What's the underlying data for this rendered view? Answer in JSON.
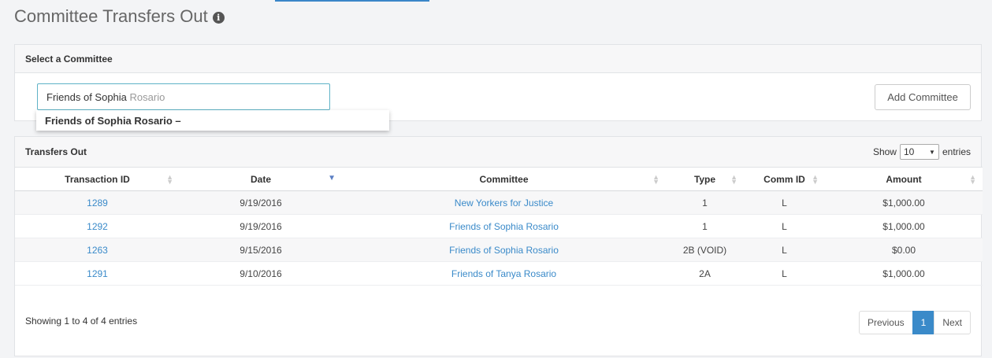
{
  "page": {
    "title": "Committee Transfers Out",
    "info_icon": "info-circle-icon"
  },
  "select_panel": {
    "heading": "Select a Committee",
    "input_typed": "Friends of Sophia",
    "input_hint": " Rosario",
    "add_button": "Add Committee",
    "suggestion": "Friends of Sophia Rosario –"
  },
  "transfers_panel": {
    "heading": "Transfers Out",
    "show_label": "Show",
    "entries_value": "10",
    "entries_label": "entries",
    "columns": [
      "Transaction ID",
      "Date",
      "Committee",
      "Type",
      "Comm ID",
      "Amount"
    ],
    "rows": [
      {
        "id": "1289",
        "date": "9/19/2016",
        "committee": "New Yorkers for Justice",
        "type": "1",
        "comm_id": "L",
        "amount": "$1,000.00"
      },
      {
        "id": "1292",
        "date": "9/19/2016",
        "committee": "Friends of Sophia Rosario",
        "type": "1",
        "comm_id": "L",
        "amount": "$1,000.00"
      },
      {
        "id": "1263",
        "date": "9/15/2016",
        "committee": "Friends of Sophia Rosario",
        "type": "2B (VOID)",
        "comm_id": "L",
        "amount": "$0.00"
      },
      {
        "id": "1291",
        "date": "9/10/2016",
        "committee": "Friends of Tanya Rosario",
        "type": "2A",
        "comm_id": "L",
        "amount": "$1,000.00"
      }
    ],
    "footer_info": "Showing 1 to 4 of 4 entries",
    "pagination": {
      "previous": "Previous",
      "current": "1",
      "next": "Next"
    }
  },
  "colors": {
    "link": "#3a8ac9",
    "input_focus_border": "#5fb3c7",
    "page_bg": "#f3f4f6"
  }
}
